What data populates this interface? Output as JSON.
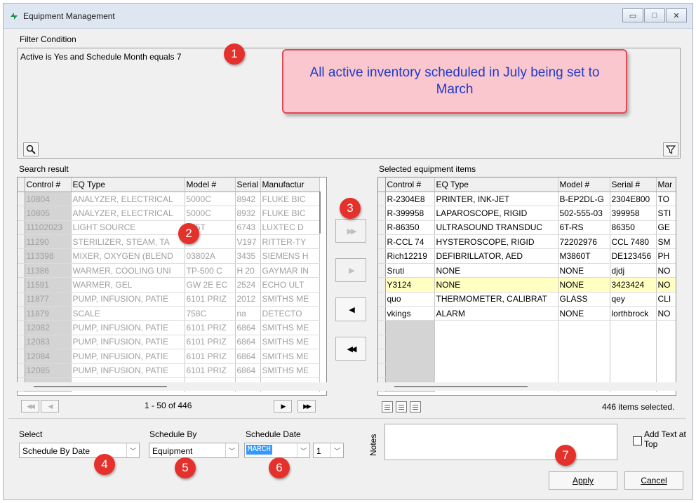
{
  "window": {
    "title": "Equipment Management"
  },
  "filter": {
    "label": "Filter Condition",
    "condition": "Active is Yes and Schedule Month equals 7"
  },
  "callout": {
    "text": "All active inventory scheduled in July being set to March"
  },
  "badges": [
    "1",
    "2",
    "3",
    "4",
    "5",
    "6",
    "7"
  ],
  "search": {
    "label": "Search result",
    "columns": [
      "Control #",
      "EQ Type",
      "Model #",
      "Serial #",
      "Manufacturer"
    ],
    "column_labels_visible": [
      "Control #",
      "EQ Type",
      "Model #",
      "Serial",
      "Manufactur"
    ],
    "rows": [
      [
        "10804",
        "ANALYZER, ELECTRICAL",
        "5000C",
        "8942",
        "FLUKE BIC"
      ],
      [
        "10805",
        "ANALYZER, ELECTRICAL",
        "5000C",
        "8932",
        "FLUKE BIC"
      ],
      [
        "11102023",
        "LIGHT SOURCE",
        "175T",
        "6743",
        "LUXTEC D"
      ],
      [
        "11290",
        "STERILIZER, STEAM, TA",
        "",
        "V197",
        "RITTER-TY"
      ],
      [
        "113398",
        "MIXER, OXYGEN (BLEND",
        "03802A",
        "3435",
        "SIEMENS H"
      ],
      [
        "11386",
        "WARMER, COOLING UNI",
        "TP-500 C",
        "H 20",
        "GAYMAR IN"
      ],
      [
        "11591",
        "WARMER, GEL",
        "GW 2E EC",
        "2524",
        "ECHO ULT"
      ],
      [
        "11877",
        "PUMP, INFUSION, PATIE",
        "6101 PRIZ",
        "2012",
        "SMITHS ME"
      ],
      [
        "11879",
        "SCALE",
        "758C",
        "na",
        "DETECTO"
      ],
      [
        "12082",
        "PUMP, INFUSION, PATIE",
        "6101 PRIZ",
        "6864",
        "SMITHS ME"
      ],
      [
        "12083",
        "PUMP, INFUSION, PATIE",
        "6101 PRIZ",
        "6864",
        "SMITHS ME"
      ],
      [
        "12084",
        "PUMP, INFUSION, PATIE",
        "6101 PRIZ",
        "6864",
        "SMITHS ME"
      ],
      [
        "12085",
        "PUMP, INFUSION, PATIE",
        "6101 PRIZ",
        "6864",
        "SMITHS ME"
      ]
    ],
    "pager": "1 - 50 of 446"
  },
  "selected": {
    "label": "Selected equipment items",
    "columns": [
      "Control #",
      "EQ Type",
      "Model #",
      "Serial #",
      "Mar"
    ],
    "rows": [
      [
        "R-2304E8",
        "PRINTER, INK-JET",
        "B-EP2DL-G",
        "2304E800",
        "TO"
      ],
      [
        "R-399958",
        "LAPAROSCOPE, RIGID",
        "502-555-03",
        "399958",
        "STI"
      ],
      [
        "R-86350",
        "ULTRASOUND TRANSDUC",
        "6T-RS",
        "86350",
        "GE"
      ],
      [
        "R-CCL 74",
        "HYSTEROSCOPE, RIGID",
        "72202976",
        "CCL 7480",
        "SM"
      ],
      [
        "Rich12219",
        "DEFIBRILLATOR, AED",
        "M3860T",
        "DE123456",
        "PH"
      ],
      [
        "Sruti",
        "NONE",
        "NONE",
        "djdj",
        "NO"
      ],
      [
        "Y3124",
        "NONE",
        "NONE",
        "3423424",
        "NO"
      ],
      [
        "quo",
        "THERMOMETER, CALIBRAT",
        "GLASS",
        "qey",
        "CLI"
      ],
      [
        "vkings",
        "ALARM",
        "NONE",
        "lorthbrock",
        "NO"
      ]
    ],
    "selected_row": 6,
    "count_text": "446 items selected."
  },
  "footer": {
    "select_label": "Select",
    "select_value": "Schedule By Date",
    "schedule_by_label": "Schedule By",
    "schedule_by_value": "Equipment",
    "schedule_date_label": "Schedule Date",
    "schedule_date_month": "MARCH",
    "schedule_date_day": "1",
    "notes_label": "Notes",
    "add_text_label": "Add Text at Top",
    "apply_label": "Apply",
    "cancel_label": "Cancel"
  },
  "icons": {
    "search": "magnifier-icon",
    "filter": "funnel-icon"
  }
}
